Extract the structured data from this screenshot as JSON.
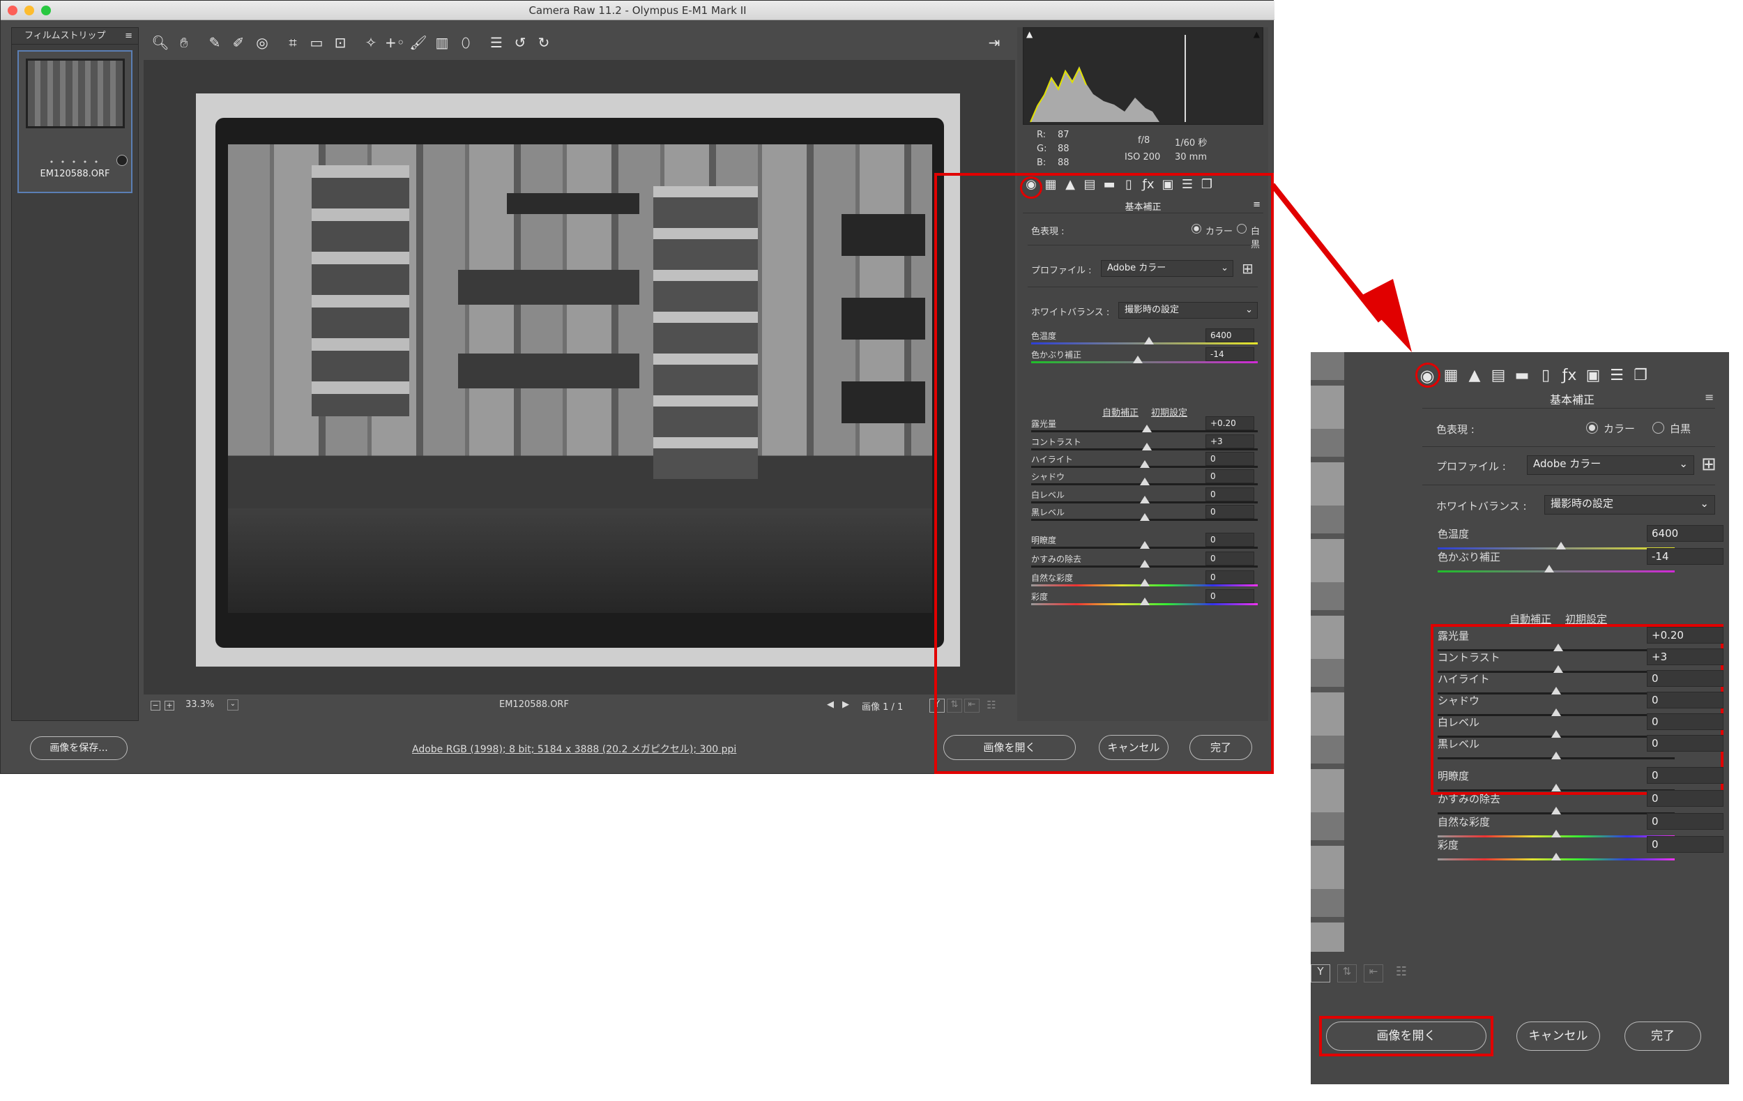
{
  "window": {
    "title": "Camera Raw 11.2  -  Olympus E-M1 Mark II"
  },
  "filmstrip": {
    "header": "フィルムストリップ",
    "thumb_name": "EM120588.ORF",
    "thumb_dots": "• • • • •"
  },
  "status": {
    "zoom": "33.3%",
    "filename": "EM120588.ORF",
    "image_count": "画像 1 / 1"
  },
  "readout": {
    "r_label": "R:",
    "r": "87",
    "g_label": "G:",
    "g": "88",
    "b_label": "B:",
    "b": "88",
    "aperture": "f/8",
    "shutter": "1/60 秒",
    "iso": "ISO 200",
    "focal": "30 mm"
  },
  "panel": {
    "title": "基本補正",
    "treatment_label": "色表現 :",
    "color_option": "カラー",
    "bw_option": "白黒",
    "profile_label": "プロファイル :",
    "profile_value": "Adobe カラー",
    "wb_label": "ホワイトバランス :",
    "wb_value": "撮影時の設定",
    "auto_link": "自動補正",
    "default_link": "初期設定",
    "sliders": [
      {
        "label": "色温度",
        "value": "6400",
        "level": 0.52
      },
      {
        "label": "色かぶり補正",
        "value": "-14",
        "level": 0.47
      },
      {
        "label": "露光量",
        "value": "+0.20",
        "level": 0.51
      },
      {
        "label": "コントラスト",
        "value": "+3",
        "level": 0.51
      },
      {
        "label": "ハイライト",
        "value": "0",
        "level": 0.5
      },
      {
        "label": "シャドウ",
        "value": "0",
        "level": 0.5
      },
      {
        "label": "白レベル",
        "value": "0",
        "level": 0.5
      },
      {
        "label": "黒レベル",
        "value": "0",
        "level": 0.5
      },
      {
        "label": "明瞭度",
        "value": "0",
        "level": 0.5
      },
      {
        "label": "かすみの除去",
        "value": "0",
        "level": 0.5
      },
      {
        "label": "自然な彩度",
        "value": "0",
        "level": 0.5
      },
      {
        "label": "彩度",
        "value": "0",
        "level": 0.5
      }
    ]
  },
  "footer": {
    "save_button": "画像を保存...",
    "workflow_link": "Adobe RGB (1998); 8 bit; 5184 x 3888 (20.2 メガピクセル); 300 ppi",
    "open_button": "画像を開く",
    "cancel_button": "キャンセル",
    "done_button": "完了"
  },
  "colors": {
    "accent_red": "#e10000",
    "panel_bg": "#454545",
    "selection_blue": "#5b7fb5"
  }
}
